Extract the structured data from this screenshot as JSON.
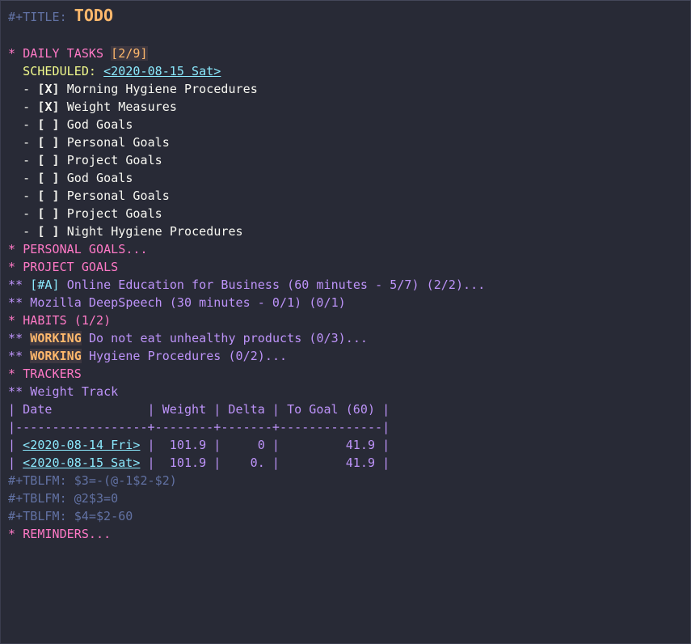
{
  "header": {
    "title_keyword": "#+TITLE:",
    "title": "TODO"
  },
  "daily_tasks": {
    "stars": "*",
    "heading": "DAILY TASKS",
    "cookie": "[2/9]",
    "scheduled_label": "SCHEDULED:",
    "scheduled_date": "<2020-08-15 Sat>",
    "items": [
      {
        "bullet": "-",
        "checkbox": "[X]",
        "text": "Morning Hygiene Procedures"
      },
      {
        "bullet": "-",
        "checkbox": "[X]",
        "text": "Weight Measures"
      },
      {
        "bullet": "-",
        "checkbox": "[ ]",
        "text": "God Goals"
      },
      {
        "bullet": "-",
        "checkbox": "[ ]",
        "text": "Personal Goals"
      },
      {
        "bullet": "-",
        "checkbox": "[ ]",
        "text": "Project Goals"
      },
      {
        "bullet": "-",
        "checkbox": "[ ]",
        "text": "God Goals"
      },
      {
        "bullet": "-",
        "checkbox": "[ ]",
        "text": "Personal Goals"
      },
      {
        "bullet": "-",
        "checkbox": "[ ]",
        "text": "Project Goals"
      },
      {
        "bullet": "-",
        "checkbox": "[ ]",
        "text": "Night Hygiene Procedures"
      }
    ]
  },
  "personal_goals": {
    "stars": "*",
    "heading": "PERSONAL GOALS..."
  },
  "project_goals": {
    "stars": "*",
    "heading": "PROJECT GOALS",
    "children": [
      {
        "stars": "**",
        "priority": "[#A]",
        "text": "Online Education for Business (60 minutes - 5/7) (2/2)..."
      },
      {
        "stars": "**",
        "text": "Mozilla DeepSpeech (30 minutes - 0/1) (0/1)"
      }
    ]
  },
  "habits": {
    "stars": "*",
    "heading": "HABITS (1/2)",
    "children": [
      {
        "stars": "**",
        "keyword": "WORKING",
        "text": "Do not eat unhealthy products (0/3)..."
      },
      {
        "stars": "**",
        "keyword": "WORKING",
        "text": "Hygiene Procedures (0/2)..."
      }
    ]
  },
  "trackers": {
    "stars": "*",
    "heading": "TRACKERS",
    "child": {
      "stars": "**",
      "text": "Weight Track"
    },
    "table": {
      "header": "| Date             | Weight | Delta | To Goal (60) |",
      "separator": "|------------------+--------+-------+--------------|",
      "rows": [
        {
          "prefix": "| ",
          "date": "<2020-08-14 Fri>",
          "rest": " |  101.9 |     0 |         41.9 |"
        },
        {
          "prefix": "| ",
          "date": "<2020-08-15 Sat>",
          "rest": " |  101.9 |    0. |         41.9 |"
        }
      ],
      "formulas": [
        "#+TBLFM: $3=-(@-1$2-$2)",
        "#+TBLFM: @2$3=0",
        "#+TBLFM: $4=$2-60"
      ]
    }
  },
  "reminders": {
    "stars": "*",
    "heading": "REMINDERS..."
  },
  "colors": {
    "background": "#282a36",
    "heading1": "#ff79c6",
    "heading2": "#bd93f9",
    "meta": "#6272a4",
    "title": "#ffb86c",
    "date_link": "#8be9fd",
    "scheduled": "#f1fa8c",
    "keyword": "#ffb86c"
  }
}
